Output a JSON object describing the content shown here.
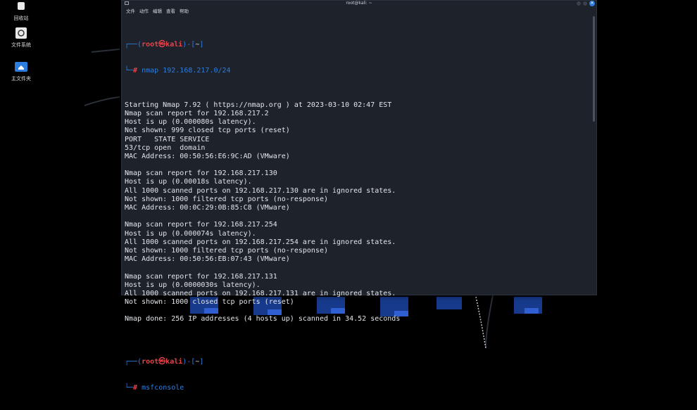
{
  "desktop": {
    "icons": [
      {
        "label": "回收站",
        "icon": "trash-icon"
      },
      {
        "label": "文件系统",
        "icon": "drive-icon"
      },
      {
        "label": "主文件夹",
        "icon": "home-folder-icon"
      }
    ]
  },
  "window": {
    "title": "root@kali: ~",
    "menu": [
      "文件",
      "动作",
      "编辑",
      "查看",
      "帮助"
    ]
  },
  "terminal": {
    "prompt1": {
      "open": "┌──(",
      "user": "root㉿kali",
      "close": ")-[",
      "dir": "~",
      "end": "]",
      "cmd_prefix": "└─",
      "hash": "#",
      "command": "nmap 192.168.217.0/24"
    },
    "output": [
      "Starting Nmap 7.92 ( https://nmap.org ) at 2023-03-10 02:47 EST",
      "Nmap scan report for 192.168.217.2",
      "Host is up (0.000080s latency).",
      "Not shown: 999 closed tcp ports (reset)",
      "PORT   STATE SERVICE",
      "53/tcp open  domain",
      "MAC Address: 00:50:56:E6:9C:AD (VMware)",
      "",
      "Nmap scan report for 192.168.217.130",
      "Host is up (0.00018s latency).",
      "All 1000 scanned ports on 192.168.217.130 are in ignored states.",
      "Not shown: 1000 filtered tcp ports (no-response)",
      "MAC Address: 00:0C:29:0B:85:C8 (VMware)",
      "",
      "Nmap scan report for 192.168.217.254",
      "Host is up (0.000074s latency).",
      "All 1000 scanned ports on 192.168.217.254 are in ignored states.",
      "Not shown: 1000 filtered tcp ports (no-response)",
      "MAC Address: 00:50:56:EB:07:43 (VMware)",
      "",
      "Nmap scan report for 192.168.217.131",
      "Host is up (0.0000030s latency).",
      "All 1000 scanned ports on 192.168.217.131 are in ignored states.",
      "Not shown: 1000 closed tcp ports (reset)",
      "",
      "Nmap done: 256 IP addresses (4 hosts up) scanned in 34.52 seconds",
      ""
    ],
    "prompt2": {
      "open": "┌──(",
      "user": "root㉿kali",
      "close": ")-[",
      "dir": "~",
      "end": "]",
      "cmd_prefix": "└─",
      "hash": "#",
      "command": "msfconsole"
    }
  },
  "colors": {
    "accent": "#2d7de0",
    "prompt_user": "#e8434b",
    "terminal_bg": "#1d222b"
  }
}
